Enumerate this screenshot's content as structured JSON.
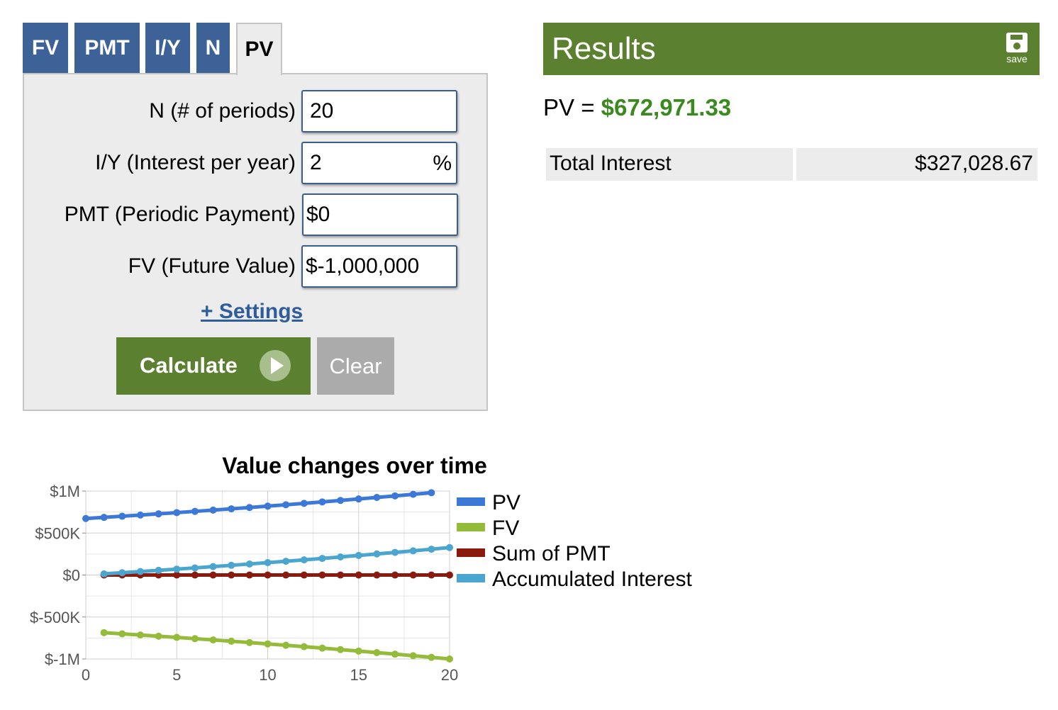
{
  "tabs": [
    {
      "label": "FV"
    },
    {
      "label": "PMT"
    },
    {
      "label": "I/Y"
    },
    {
      "label": "N"
    },
    {
      "label": "PV",
      "active": true
    }
  ],
  "form": {
    "n_label": "N (# of periods)",
    "n_value": "20",
    "iy_label": "I/Y (Interest per year)",
    "iy_value": "2",
    "iy_suffix": "%",
    "pmt_label": "PMT (Periodic Payment)",
    "pmt_value": "$0",
    "fv_label": "FV (Future Value)",
    "fv_value": "$-1,000,000",
    "settings_link": "+ Settings",
    "calculate_label": "Calculate",
    "clear_label": "Clear"
  },
  "results": {
    "title": "Results",
    "save_label": "save",
    "pv_prefix": "PV = ",
    "pv_value": "$672,971.33",
    "total_interest_label": "Total Interest",
    "total_interest_value": "$327,028.67"
  },
  "colors": {
    "tab_blue": "#3c6297",
    "results_green": "#5b8130",
    "pv_green": "#3a8a20",
    "link_blue": "#2f5d9c"
  },
  "chart_data": {
    "type": "line",
    "title": "Value changes over time",
    "xlabel": "",
    "ylabel": "",
    "xlim": [
      0,
      20
    ],
    "ylim": [
      -1000000,
      1000000
    ],
    "x_ticks": [
      "0",
      "5",
      "10",
      "15",
      "20"
    ],
    "y_ticks": [
      "$1M",
      "$500K",
      "$0",
      "$-500K",
      "$-1M"
    ],
    "grid": true,
    "legend_position": "right",
    "series": [
      {
        "name": "PV",
        "color": "#3b78d8",
        "x": [
          0,
          1,
          2,
          3,
          4,
          5,
          6,
          7,
          8,
          9,
          10,
          11,
          12,
          13,
          14,
          15,
          16,
          17,
          18,
          19
        ],
        "y": [
          672971,
          686431,
          700159,
          714162,
          728445,
          743014,
          757874,
          773032,
          788492,
          804262,
          820347,
          836754,
          853489,
          870559,
          887970,
          905730,
          923844,
          942321,
          961168,
          980392
        ]
      },
      {
        "name": "FV",
        "color": "#94bb3a",
        "x": [
          1,
          2,
          3,
          4,
          5,
          6,
          7,
          8,
          9,
          10,
          11,
          12,
          13,
          14,
          15,
          16,
          17,
          18,
          19,
          20
        ],
        "y": [
          -686431,
          -700159,
          -714162,
          -728445,
          -743014,
          -757874,
          -773032,
          -788492,
          -804262,
          -820347,
          -836754,
          -853489,
          -870559,
          -887970,
          -905730,
          -923844,
          -942321,
          -961168,
          -980392,
          -1000000
        ]
      },
      {
        "name": "Sum of PMT",
        "color": "#8b1a0e",
        "x": [
          1,
          2,
          3,
          4,
          5,
          6,
          7,
          8,
          9,
          10,
          11,
          12,
          13,
          14,
          15,
          16,
          17,
          18,
          19,
          20
        ],
        "y": [
          0,
          0,
          0,
          0,
          0,
          0,
          0,
          0,
          0,
          0,
          0,
          0,
          0,
          0,
          0,
          0,
          0,
          0,
          0,
          0
        ]
      },
      {
        "name": "Accumulated Interest",
        "color": "#4aa6cf",
        "x": [
          1,
          2,
          3,
          4,
          5,
          6,
          7,
          8,
          9,
          10,
          11,
          12,
          13,
          14,
          15,
          16,
          17,
          18,
          19,
          20
        ],
        "y": [
          13460,
          27188,
          41191,
          55474,
          70043,
          84903,
          100061,
          115521,
          131291,
          147376,
          163783,
          180518,
          197588,
          214999,
          232759,
          250873,
          269350,
          288197,
          307421,
          327029
        ]
      }
    ]
  }
}
